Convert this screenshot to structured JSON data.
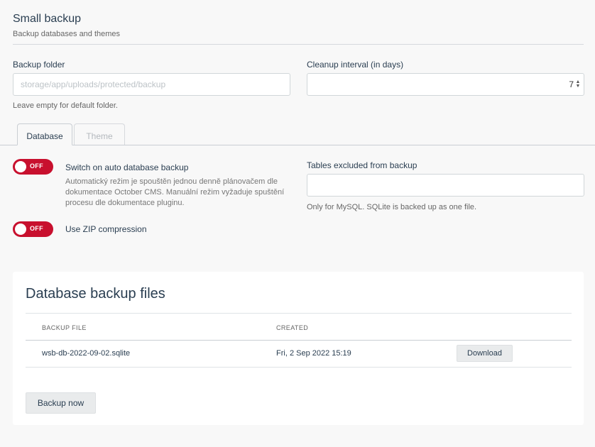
{
  "header": {
    "title": "Small backup",
    "subtitle": "Backup databases and themes"
  },
  "fields": {
    "backup_folder": {
      "label": "Backup folder",
      "placeholder": "storage/app/uploads/protected/backup",
      "value": "",
      "help": "Leave empty for default folder."
    },
    "cleanup_interval": {
      "label": "Cleanup interval (in days)",
      "value": "7"
    },
    "tables_excluded": {
      "label": "Tables excluded from backup",
      "value": "",
      "help": "Only for MySQL. SQLite is backed up as one file."
    }
  },
  "tabs": [
    {
      "label": "Database",
      "active": true
    },
    {
      "label": "Theme",
      "active": false
    }
  ],
  "toggles": {
    "auto_backup": {
      "state_label": "OFF",
      "label": "Switch on auto database backup",
      "description": "Automatický režim je spouštěn jednou denně plánovačem dle dokumentace October CMS. Manuální režim vyžaduje spuštění procesu dle dokumentace pluginu."
    },
    "zip": {
      "state_label": "OFF",
      "label": "Use ZIP compression"
    }
  },
  "backup_files": {
    "title": "Database backup files",
    "columns": [
      "BACKUP FILE",
      "CREATED"
    ],
    "rows": [
      {
        "file": "wsb-db-2022-09-02.sqlite",
        "created": "Fri, 2 Sep 2022 15:19",
        "action": "Download"
      }
    ],
    "backup_now_label": "Backup now"
  },
  "colors": {
    "toggle_off": "#c8102e",
    "background": "#f8f8f8",
    "text": "#2a3e51"
  }
}
